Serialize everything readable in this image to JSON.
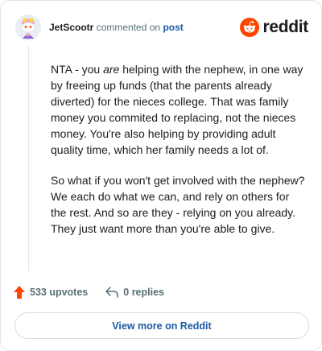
{
  "comment": {
    "author": "JetScootr",
    "commented_on_text": "commented on",
    "post_link_label": "post",
    "paragraphs": [
      {
        "pre": "NTA - you ",
        "em": "are",
        "post": " helping with the nephew, in one way by freeing up funds (that the parents already diverted) for the nieces college. That was family money you commited to replacing, not the nieces money. You're also helping by providing adult quality time, which her family needs a lot of."
      },
      {
        "pre": "So what if you won't get involved with the nephew? We each do what we can, and rely on others for the rest. And so are they - relying on you already. They just want more than you're able to give.",
        "em": "",
        "post": ""
      }
    ]
  },
  "brand": {
    "wordmark": "reddit",
    "color": "#ff4500"
  },
  "actions": {
    "upvotes_label": "533 upvotes",
    "replies_label": "0 replies"
  },
  "view_more_label": "View more on Reddit",
  "colors": {
    "link": "#1a5aa5",
    "upvote": "#ff4500",
    "muted": "#576f76"
  }
}
